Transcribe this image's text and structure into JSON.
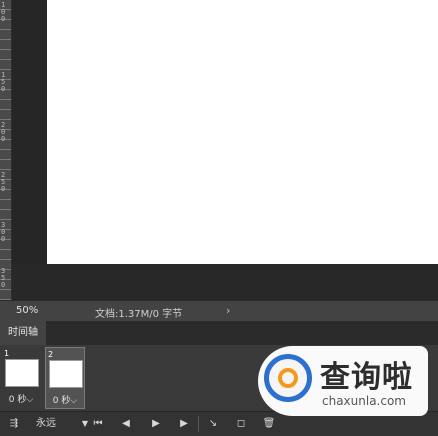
{
  "ruler": {
    "labels": [
      "100",
      "150",
      "200",
      "250",
      "300",
      "350"
    ]
  },
  "status": {
    "zoom": "50%",
    "doc_info": "文档:1.37M/0 字节",
    "arrow": "›"
  },
  "timeline": {
    "tab_label": "时间轴",
    "frames": [
      {
        "number": "1",
        "delay": "0 秒",
        "selected": false
      },
      {
        "number": "2",
        "delay": "0 秒",
        "selected": true
      }
    ],
    "loop_option": "永远",
    "controls": {
      "convert": "⇶",
      "first": "⏮",
      "prev": "◀",
      "play": "▶",
      "next": "▶",
      "tween": "↘",
      "duplicate": "◻",
      "delete": "🗑"
    }
  },
  "watermark": {
    "title": "查询啦",
    "url": "chaxunla.com"
  }
}
